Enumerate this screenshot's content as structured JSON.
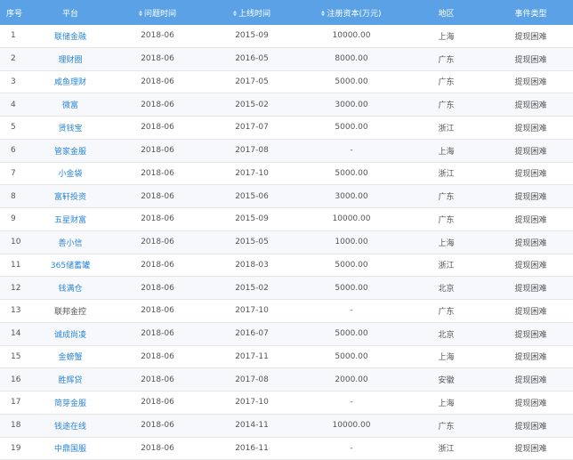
{
  "table": {
    "headers": {
      "no": "序号",
      "platform": "平台",
      "problem_time": "问题时间",
      "launch_time": "上线时间",
      "capital": "注册资本(万元)",
      "region": "地区",
      "event_type": "事件类型"
    },
    "rows": [
      {
        "no": "1",
        "platform": "联储金融",
        "problem_time": "2018-06",
        "launch_time": "2015-09",
        "capital": "10000.00",
        "region": "上海",
        "event_type": "提现困难",
        "link": true
      },
      {
        "no": "2",
        "platform": "理财圈",
        "problem_time": "2018-06",
        "launch_time": "2016-05",
        "capital": "8000.00",
        "region": "广东",
        "event_type": "提现困难",
        "link": true
      },
      {
        "no": "3",
        "platform": "咸鱼理财",
        "problem_time": "2018-06",
        "launch_time": "2017-05",
        "capital": "5000.00",
        "region": "广东",
        "event_type": "提现困难",
        "link": true
      },
      {
        "no": "4",
        "platform": "微富",
        "problem_time": "2018-06",
        "launch_time": "2015-02",
        "capital": "3000.00",
        "region": "广东",
        "event_type": "提现困难",
        "link": true
      },
      {
        "no": "5",
        "platform": "贤钱宝",
        "problem_time": "2018-06",
        "launch_time": "2017-07",
        "capital": "5000.00",
        "region": "浙江",
        "event_type": "提现困难",
        "link": true
      },
      {
        "no": "6",
        "platform": "管家金服",
        "problem_time": "2018-06",
        "launch_time": "2017-08",
        "capital": "-",
        "region": "上海",
        "event_type": "提现困难",
        "link": true
      },
      {
        "no": "7",
        "platform": "小金袋",
        "problem_time": "2018-06",
        "launch_time": "2017-10",
        "capital": "5000.00",
        "region": "浙江",
        "event_type": "提现困难",
        "link": true
      },
      {
        "no": "8",
        "platform": "富轩投资",
        "problem_time": "2018-06",
        "launch_time": "2015-06",
        "capital": "3000.00",
        "region": "广东",
        "event_type": "提现困难",
        "link": true
      },
      {
        "no": "9",
        "platform": "五星财富",
        "problem_time": "2018-06",
        "launch_time": "2015-09",
        "capital": "10000.00",
        "region": "广东",
        "event_type": "提现困难",
        "link": true
      },
      {
        "no": "10",
        "platform": "善小信",
        "problem_time": "2018-06",
        "launch_time": "2015-05",
        "capital": "1000.00",
        "region": "上海",
        "event_type": "提现困难",
        "link": true
      },
      {
        "no": "11",
        "platform": "365储蓄罐",
        "problem_time": "2018-06",
        "launch_time": "2018-03",
        "capital": "5000.00",
        "region": "浙江",
        "event_type": "提现困难",
        "link": true
      },
      {
        "no": "12",
        "platform": "钱满仓",
        "problem_time": "2018-06",
        "launch_time": "2015-02",
        "capital": "5000.00",
        "region": "北京",
        "event_type": "提现困难",
        "link": true
      },
      {
        "no": "13",
        "platform": "联邦金控",
        "problem_time": "2018-06",
        "launch_time": "2017-10",
        "capital": "-",
        "region": "广东",
        "event_type": "提现困难",
        "link": false
      },
      {
        "no": "14",
        "platform": "诚成尚凌",
        "problem_time": "2018-06",
        "launch_time": "2016-07",
        "capital": "5000.00",
        "region": "北京",
        "event_type": "提现困难",
        "link": true
      },
      {
        "no": "15",
        "platform": "金螃蟹",
        "problem_time": "2018-06",
        "launch_time": "2017-11",
        "capital": "5000.00",
        "region": "上海",
        "event_type": "提现困难",
        "link": true
      },
      {
        "no": "16",
        "platform": "胜辉贷",
        "problem_time": "2018-06",
        "launch_time": "2017-08",
        "capital": "2000.00",
        "region": "安徽",
        "event_type": "提现困难",
        "link": true
      },
      {
        "no": "17",
        "platform": "简芽金服",
        "problem_time": "2018-06",
        "launch_time": "2017-10",
        "capital": "-",
        "region": "上海",
        "event_type": "提现困难",
        "link": true
      },
      {
        "no": "18",
        "platform": "钱途在线",
        "problem_time": "2018-06",
        "launch_time": "2014-11",
        "capital": "10000.00",
        "region": "广东",
        "event_type": "提现困难",
        "link": true
      },
      {
        "no": "19",
        "platform": "中鼎国服",
        "problem_time": "2018-06",
        "launch_time": "2016-11",
        "capital": "-",
        "region": "浙江",
        "event_type": "提现困难",
        "link": true
      }
    ]
  }
}
